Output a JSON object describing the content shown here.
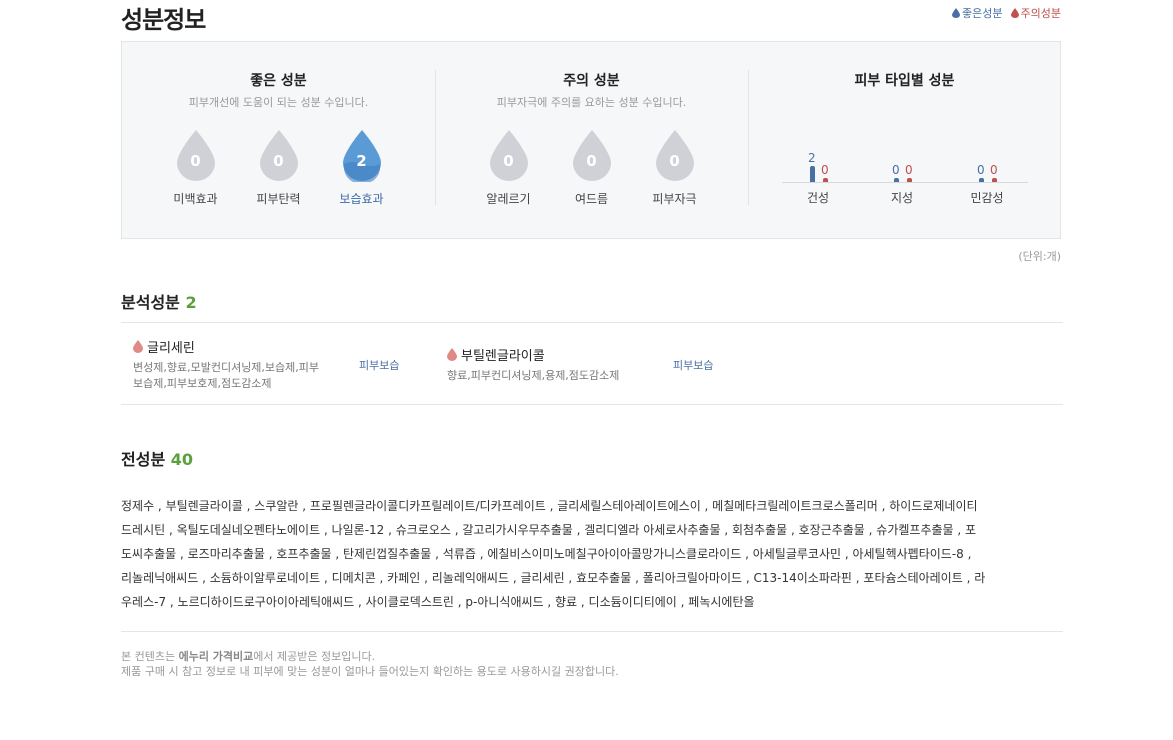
{
  "page_title": "성분정보",
  "legend": {
    "good": "좋은성분",
    "caution": "주의성분"
  },
  "colors": {
    "good": "#4a6fa5",
    "caution": "#c0504d",
    "drop_inactive": "#cfd1d6",
    "drop_active": "#5b9bd5",
    "count_green": "#5aa13c"
  },
  "good_section": {
    "title": "좋은 성분",
    "subtitle": "피부개선에 도움이 되는 성분 수입니다.",
    "items": [
      {
        "label": "미백효과",
        "count": "0",
        "active": false
      },
      {
        "label": "피부탄력",
        "count": "0",
        "active": false
      },
      {
        "label": "보습효과",
        "count": "2",
        "active": true
      }
    ]
  },
  "caution_section": {
    "title": "주의 성분",
    "subtitle": "피부자극에 주의를 요하는 성분 수입니다.",
    "items": [
      {
        "label": "알레르기",
        "count": "0",
        "active": false
      },
      {
        "label": "여드름",
        "count": "0",
        "active": false
      },
      {
        "label": "피부자극",
        "count": "0",
        "active": false
      }
    ]
  },
  "skin_section": {
    "title": "피부 타입별 성분",
    "types": [
      {
        "label": "건성",
        "good": "2",
        "caution": "0"
      },
      {
        "label": "지성",
        "good": "0",
        "caution": "0"
      },
      {
        "label": "민감성",
        "good": "0",
        "caution": "0"
      }
    ]
  },
  "unit_label": "(단위:개)",
  "analysis": {
    "title": "분석성분",
    "count": "2",
    "items": [
      {
        "name": "글리세린",
        "purpose_line1": "변성제,향료,모발컨디셔닝제,보습제,피부",
        "purpose_line2": "보습제,피부보호제,점도감소제",
        "tag": "피부보습"
      },
      {
        "name": "부틸렌글라이콜",
        "purpose_line1": "향료,피부컨디셔닝제,용제,점도감소제",
        "purpose_line2": "",
        "tag": "피부보습"
      }
    ]
  },
  "full": {
    "title": "전성분",
    "count": "40",
    "lines": [
      "정제수 , 부틸렌글라이콜 , 스쿠알란 , 프로필렌글라이콜디카프릴레이트/디카프레이트 , 글리세릴스테아레이트에스이 , 메칠메타크릴레이트크로스폴리머 , 하이드로제네이티",
      "드레시틴 , 옥틸도데실네오펜타노에이트 , 나일론-12 , 슈크로오스 , 갈고리가시우무추출물 , 겔리디엘라 아세로사추출물 , 회첨추출물 , 호장근추출물 , 슈가켈프추출물 , 포",
      "도씨추출물 , 로즈마리추출물 , 호프추출물 , 탄제린껍질추출물 , 석류즙 , 에칠비스이미노메칠구아이아콜망가니스클로라이드 , 아세틸글루코사민 , 아세틸헥사펩타이드-8 ,",
      "리놀레닉애씨드 , 소듐하이알루로네이트 , 디메치콘 , 카페인 , 리놀레익애씨드 , 글리세린 , 효모추출물 , 폴리아크릴아마이드 , C13-14이소파라핀 , 포타슘스테아레이트 , 라",
      "우레스-7 , 노르디하이드로구아이아레틱애씨드 , 사이클로덱스트린 , p-아니식애씨드 , 향료 , 디소듐이디티에이 , 페녹시에탄올"
    ]
  },
  "footer": {
    "prefix": "본 컨텐츠는 ",
    "provider": "에누리 가격비교",
    "suffix": "에서 제공받은 정보입니다.",
    "line2": "제품 구매 시 참고 정보로 내 피부에 맞는 성분이 얼마나 들어있는지 확인하는 용도로 사용하시길 권장합니다."
  }
}
